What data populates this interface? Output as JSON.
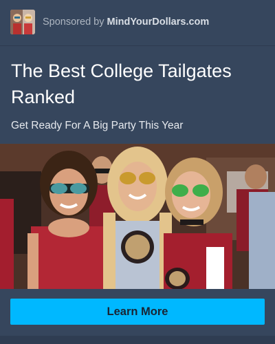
{
  "post": {
    "sponsor_prefix": "Sponsored by",
    "sponsor_name": "MindYourDollars.com",
    "avatar_icon": "advertiser-avatar",
    "title": "The Best College Tailgates Ranked",
    "subtitle": "Get Ready For A Big Party This Year",
    "image_description_icon": "tailgate-photo",
    "cta_label": "Learn More"
  },
  "colors": {
    "background": "#36465d",
    "cta": "#00b8ff",
    "title": "#ffffff",
    "sponsor_name": "#d9dee5"
  }
}
